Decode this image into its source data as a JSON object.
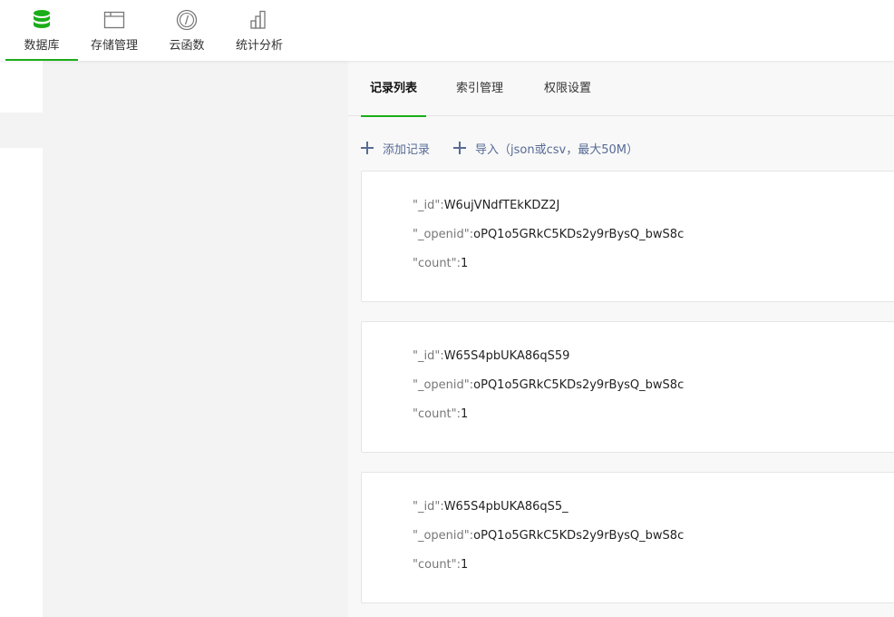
{
  "toolbar": {
    "items": [
      {
        "id": "db",
        "label": "数据库",
        "icon": "database-icon",
        "active": true
      },
      {
        "id": "storage",
        "label": "存储管理",
        "icon": "folder-icon",
        "active": false
      },
      {
        "id": "func",
        "label": "云函数",
        "icon": "cloud-function-icon",
        "active": false
      },
      {
        "id": "stats",
        "label": "统计分析",
        "icon": "bar-chart-icon",
        "active": false
      }
    ]
  },
  "tabs": [
    {
      "label": "记录列表",
      "active": true
    },
    {
      "label": "索引管理",
      "active": false
    },
    {
      "label": "权限设置",
      "active": false
    }
  ],
  "actions": {
    "add_label": "添加记录",
    "import_label": "导入（json或csv，最大50M）"
  },
  "records": [
    {
      "id_key": "\"_id\":",
      "id_val": "W6ujVNdfTEkKDZ2J",
      "openid_key": "\"_openid\":",
      "openid_val": "oPQ1o5GRkC5KDs2y9rBysQ_bwS8c",
      "count_key": "\"count\":",
      "count_val": "1"
    },
    {
      "id_key": "\"_id\":",
      "id_val": "W65S4pbUKA86qS59",
      "openid_key": "\"_openid\":",
      "openid_val": "oPQ1o5GRkC5KDs2y9rBysQ_bwS8c",
      "count_key": "\"count\":",
      "count_val": "1"
    },
    {
      "id_key": "\"_id\":",
      "id_val": "W65S4pbUKA86qS5_",
      "openid_key": "\"_openid\":",
      "openid_val": "oPQ1o5GRkC5KDs2y9rBysQ_bwS8c",
      "count_key": "\"count\":",
      "count_val": "1"
    }
  ],
  "colors": {
    "accent": "#1aad19",
    "link": "#576b95"
  }
}
